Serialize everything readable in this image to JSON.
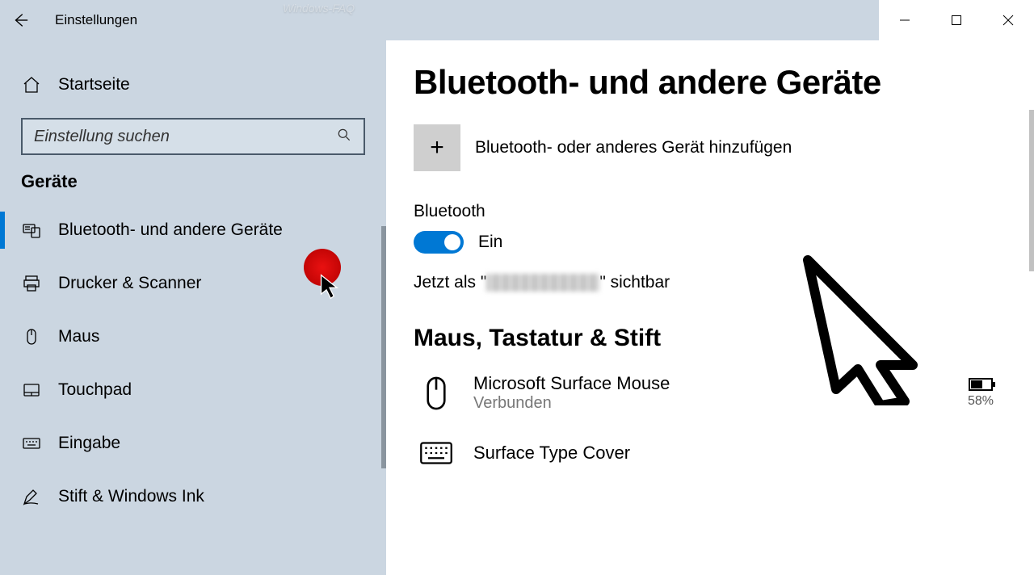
{
  "titlebar": {
    "app_title": "Einstellungen",
    "watermark": "Windows-FAQ"
  },
  "sidebar": {
    "home_label": "Startseite",
    "search_placeholder": "Einstellung suchen",
    "section_label": "Geräte",
    "items": [
      {
        "label": "Bluetooth- und andere Geräte"
      },
      {
        "label": "Drucker & Scanner"
      },
      {
        "label": "Maus"
      },
      {
        "label": "Touchpad"
      },
      {
        "label": "Eingabe"
      },
      {
        "label": "Stift & Windows Ink"
      }
    ]
  },
  "main": {
    "page_title": "Bluetooth- und andere Geräte",
    "add_device_label": "Bluetooth- oder anderes Gerät hinzufügen",
    "bluetooth_label": "Bluetooth",
    "toggle_state": "Ein",
    "visible_prefix": "Jetzt als \"",
    "visible_suffix": "\" sichtbar",
    "section_heading": "Maus, Tastatur & Stift",
    "devices": [
      {
        "name": "Microsoft Surface Mouse",
        "status": "Verbunden",
        "battery_pct": "58%"
      },
      {
        "name": "Surface Type Cover"
      }
    ]
  }
}
